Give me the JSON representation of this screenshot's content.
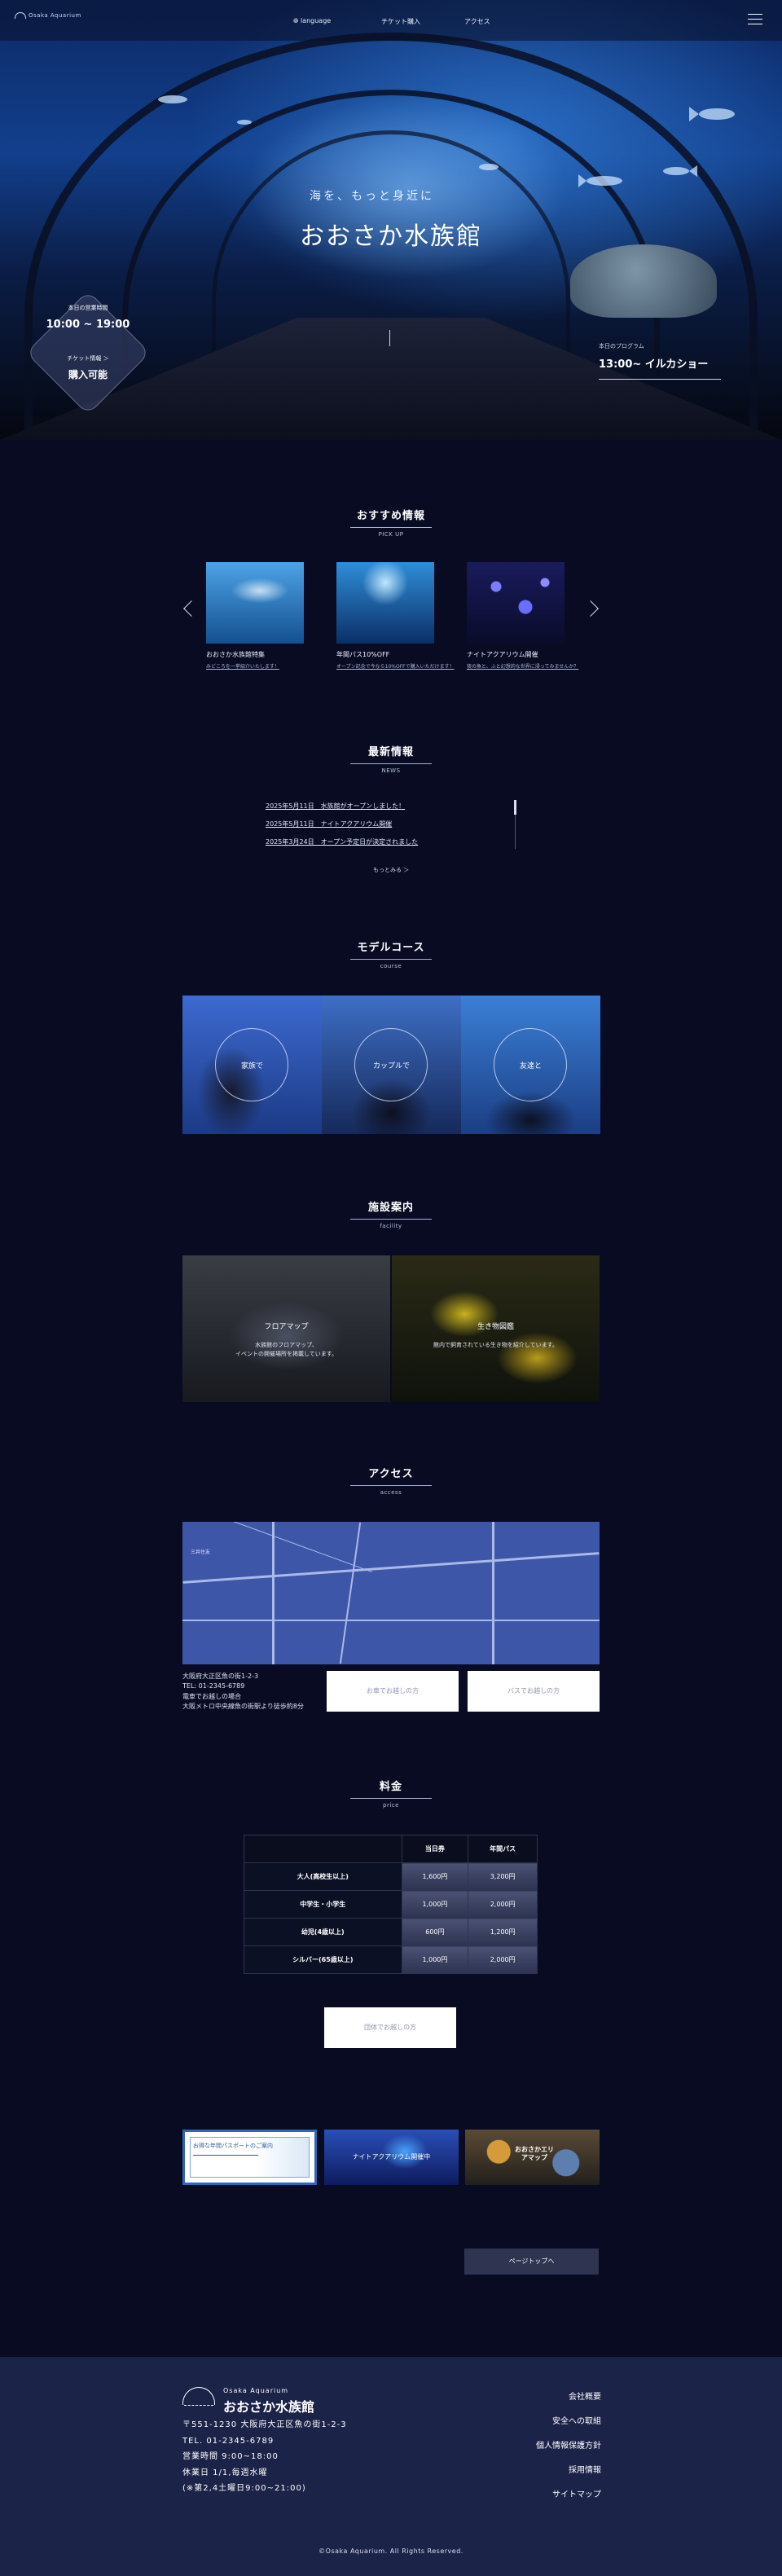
{
  "header": {
    "logo": "Osaka Aquarium",
    "nav": [
      "language",
      "チケット購入",
      "アクセス"
    ]
  },
  "hero": {
    "catch": "海を、もっと身近に",
    "title": "おおさか水族館",
    "hours_label": "本日の営業時間",
    "hours": "10:00 ~ 19:00",
    "ticket_label": "チケット情報 ＞",
    "ticket_status": "購入可能",
    "program_label": "本日のプログラム",
    "program": "13:00~ イルカショー"
  },
  "pickup": {
    "title": "おすすめ情報",
    "sub": "PICK UP",
    "cards": [
      {
        "title": "おおさか水族館特集",
        "sub": "みどころを一挙紹介いたします！"
      },
      {
        "title": "年間パス10%OFF",
        "sub": "オープン記念で今なら10%OFFで購入いただけます！"
      },
      {
        "title": "ナイトアクアリウム開催",
        "sub": "夜の魚と、ふと幻想的な世界に浸ってみませんか？"
      }
    ]
  },
  "news": {
    "title": "最新情報",
    "sub": "NEWS",
    "items": [
      "2025年5月11日　水族館がオープンしました！",
      "2025年5月11日　ナイトアクアリウム開催",
      "2025年3月24日　オープン予定日が決定されました"
    ],
    "more": "もっとみる ＞"
  },
  "course": {
    "title": "モデルコース",
    "sub": "course",
    "items": [
      "家族で",
      "カップルで",
      "友達と"
    ]
  },
  "facility": {
    "title": "施設案内",
    "sub": "facility",
    "items": [
      {
        "title": "フロアマップ",
        "desc": "水族館のフロアマップ、\nイベントの開催場所を掲載しています。"
      },
      {
        "title": "生き物図鑑",
        "desc": "館内で飼育されている生き物を紹介しています。"
      }
    ]
  },
  "access": {
    "title": "アクセス",
    "sub": "access",
    "map_label": "三井住友",
    "address": [
      "大阪府大正区魚の街1-2-3",
      "TEL: 01-2345-6789",
      "電車でお越しの場合",
      "大阪メトロ中央線魚の街駅より徒歩約8分"
    ],
    "buttons": [
      "お車でお越しの方",
      "バスでお越しの方"
    ]
  },
  "price": {
    "title": "料金",
    "sub": "price",
    "headers": [
      "",
      "当日券",
      "年間パス"
    ],
    "rows": [
      [
        "大人(高校生以上)",
        "1,600円",
        "3,200円"
      ],
      [
        "中学生・小学生",
        "1,000円",
        "2,000円"
      ],
      [
        "幼児(4歳以上)",
        "600円",
        "1,200円"
      ],
      [
        "シルバー(65歳以上)",
        "1,000円",
        "2,000円"
      ]
    ],
    "button": "団体でお越しの方"
  },
  "banners": [
    "お得な年間パスポートのご案内",
    "ナイトアクアリウム開催中",
    "おおさかエリアマップ"
  ],
  "pagetop": "ページトップへ",
  "footer": {
    "name_en": "Osaka Aquarium",
    "name": "おおさか水族館",
    "info": [
      "〒551-1230 大阪府大正区魚の街1-2-3",
      "TEL. 01-2345-6789",
      "営業時間  9:00~18:00",
      "休業日  1/1,毎週水曜",
      "(※第2,4土曜日9:00~21:00)"
    ],
    "links": [
      "会社概要",
      "安全への取組",
      "個人情報保護方針",
      "採用情報",
      "サイトマップ"
    ],
    "copyright": "©Osaka Aquarium. All Rights Reserved."
  },
  "colors": {
    "background": "#080b22",
    "footer": "#1c2348",
    "accent": "#3d56a8"
  }
}
